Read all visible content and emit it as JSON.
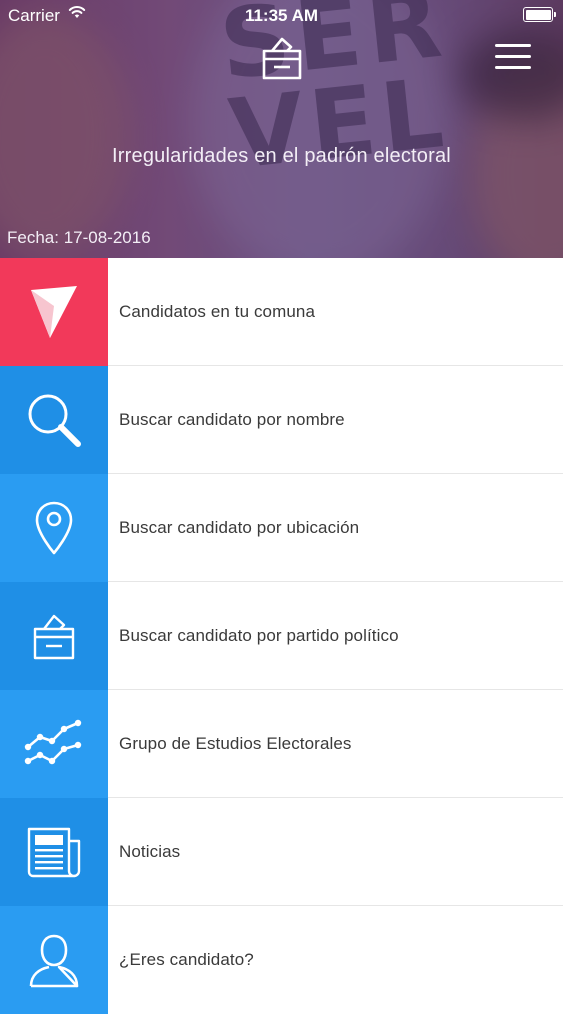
{
  "status_bar": {
    "carrier": "Carrier",
    "time": "11:35 AM"
  },
  "hero": {
    "background_text": "SER\nVEL",
    "title": "Irregularidades en el padrón electoral",
    "date": "Fecha: 17-08-2016",
    "logo_icon": "ballot-box-icon",
    "menu_icon": "hamburger-menu-icon"
  },
  "menu": {
    "items": [
      {
        "label": "Candidatos en tu comuna",
        "icon": "location-arrow-icon",
        "color": "#f2395a"
      },
      {
        "label": "Buscar candidato por nombre",
        "icon": "search-icon",
        "color": "#1f8fe6"
      },
      {
        "label": "Buscar candidato por ubicación",
        "icon": "map-pin-icon",
        "color": "#2a9cf2"
      },
      {
        "label": "Buscar candidato por partido político",
        "icon": "ballot-box-icon",
        "color": "#1f8fe6"
      },
      {
        "label": "Grupo de Estudios Electorales",
        "icon": "line-chart-icon",
        "color": "#2a9cf2"
      },
      {
        "label": "Noticias",
        "icon": "newspaper-icon",
        "color": "#1f8fe6"
      },
      {
        "label": "¿Eres candidato?",
        "icon": "user-icon",
        "color": "#2a9cf2"
      }
    ]
  }
}
